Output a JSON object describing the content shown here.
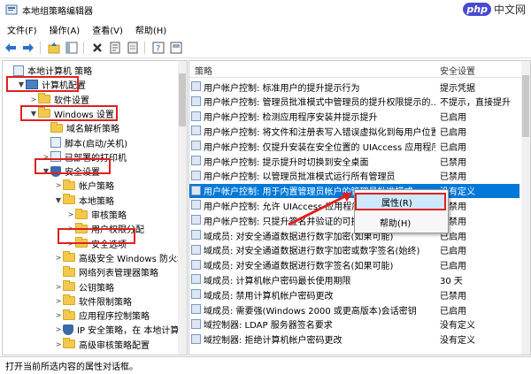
{
  "window": {
    "title": "本地组策略编辑器"
  },
  "watermark": {
    "badge": "php",
    "text": "中文网"
  },
  "menu": [
    "文件(F)",
    "操作(A)",
    "查看(V)",
    "帮助(H)"
  ],
  "toolbar": {
    "icons": [
      "back-icon",
      "forward-icon",
      "up-icon",
      "show-hide-tree-icon",
      "delete-icon",
      "properties-icon",
      "export-icon",
      "help-icon",
      "view-icon"
    ]
  },
  "tree": [
    {
      "label": "本地计算机 策略",
      "level": 0,
      "icon": "policy",
      "arrow": ""
    },
    {
      "label": "计算机配置",
      "level": 1,
      "icon": "computer",
      "arrow": "▼"
    },
    {
      "label": "软件设置",
      "level": 2,
      "icon": "folder",
      "arrow": ">"
    },
    {
      "label": "Windows 设置",
      "level": 2,
      "icon": "folder",
      "arrow": "▼"
    },
    {
      "label": "域名解析策略",
      "level": 3,
      "icon": "folder",
      "arrow": ""
    },
    {
      "label": "脚本(启动/关机)",
      "level": 3,
      "icon": "policy",
      "arrow": ""
    },
    {
      "label": "已部署的打印机",
      "level": 3,
      "icon": "policy",
      "arrow": ">"
    },
    {
      "label": "安全设置",
      "level": 3,
      "icon": "shield",
      "arrow": "▼"
    },
    {
      "label": "帐户策略",
      "level": 4,
      "icon": "folder",
      "arrow": ">"
    },
    {
      "label": "本地策略",
      "level": 4,
      "icon": "folder",
      "arrow": "▼"
    },
    {
      "label": "审核策略",
      "level": 5,
      "icon": "folder",
      "arrow": ">"
    },
    {
      "label": "用户权限分配",
      "level": 5,
      "icon": "folder",
      "arrow": ">"
    },
    {
      "label": "安全选项",
      "level": 5,
      "icon": "folder",
      "arrow": ">"
    },
    {
      "label": "高级安全 Windows 防火墙",
      "level": 4,
      "icon": "folder",
      "arrow": ">"
    },
    {
      "label": "网络列表管理器策略",
      "level": 4,
      "icon": "folder",
      "arrow": ""
    },
    {
      "label": "公钥策略",
      "level": 4,
      "icon": "folder",
      "arrow": ">"
    },
    {
      "label": "软件限制策略",
      "level": 4,
      "icon": "folder",
      "arrow": ">"
    },
    {
      "label": "应用程序控制策略",
      "level": 4,
      "icon": "folder",
      "arrow": ">"
    },
    {
      "label": "IP 安全策略，在 本地计算",
      "level": 4,
      "icon": "shield",
      "arrow": ">"
    },
    {
      "label": "高级审核策略配置",
      "level": 4,
      "icon": "folder",
      "arrow": ">"
    }
  ],
  "columns": {
    "policy": "策略",
    "setting": "安全设置"
  },
  "policies": [
    {
      "name": "用户帐户控制: 标准用户的提升提示行为",
      "setting": "提示凭据"
    },
    {
      "name": "用户帐户控制: 管理员批准模式中管理员的提升权限提示的...",
      "setting": "不提示，直接提升"
    },
    {
      "name": "用户帐户控制: 检测应用程序安装并提示提升",
      "setting": "已启用"
    },
    {
      "name": "用户帐户控制: 将文件和注册表写入错误虚拟化到每用户位置",
      "setting": "已启用"
    },
    {
      "name": "用户帐户控制: 仅提升安装在安全位置的 UIAccess 应用程序",
      "setting": "已启用"
    },
    {
      "name": "用户帐户控制: 提示提升时切换到安全桌面",
      "setting": "已禁用"
    },
    {
      "name": "用户帐户控制: 以管理员批准模式运行所有管理员",
      "setting": "已禁用"
    },
    {
      "name": "用户帐户控制: 用于内置管理员帐户的管理员批准模式",
      "setting": "没有定义"
    },
    {
      "name": "用户帐户控制: 允许 UIAccess 应用程序...",
      "setting": "已禁用"
    },
    {
      "name": "用户帐户控制: 只提升签名并验证的可执行...",
      "setting": "已禁用"
    },
    {
      "name": "域成员: 对安全通道数据进行数字加密(如果可能)",
      "setting": "已启用"
    },
    {
      "name": "域成员: 对安全通道数据进行数字加密或数字签名(始终)",
      "setting": "已启用"
    },
    {
      "name": "域成员: 对安全通道数据进行数字签名(如果可能)",
      "setting": "已启用"
    },
    {
      "name": "域成员: 计算机帐户密码最长使用期限",
      "setting": "30 天"
    },
    {
      "name": "域成员: 禁用计算机帐户密码更改",
      "setting": "已禁用"
    },
    {
      "name": "域成员: 需要强(Windows 2000 或更高版本)会话密钥",
      "setting": "已启用"
    },
    {
      "name": "域控制器: LDAP 服务器签名要求",
      "setting": "没有定义"
    },
    {
      "name": "域控制器: 拒绝计算机帐户密码更改",
      "setting": "没有定义"
    }
  ],
  "context_menu": {
    "properties": "属性(R)",
    "help": "帮助(H)"
  },
  "status": {
    "text": "打开当前所选内容的属性对话框。"
  },
  "colors": {
    "selection": "#0078d7",
    "highlight_border": "#e02020"
  }
}
